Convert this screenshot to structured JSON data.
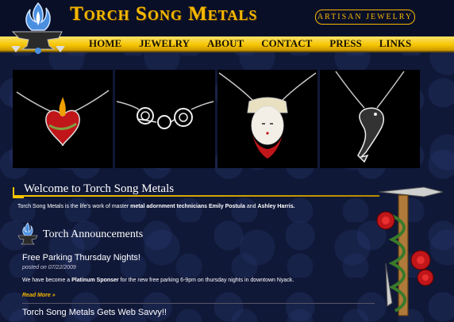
{
  "header": {
    "site_title": "Torch Song Metals",
    "badge": "ARTISAN JEWELRY"
  },
  "nav": {
    "items": [
      {
        "label": "HOME"
      },
      {
        "label": "JEWELRY"
      },
      {
        "label": "ABOUT"
      },
      {
        "label": "CONTACT"
      },
      {
        "label": "PRESS"
      },
      {
        "label": "LINKS"
      }
    ]
  },
  "welcome": {
    "title": "Welcome to Torch Song Metals",
    "intro_prefix": "Torch Song Metals is the life's work of master ",
    "intro_bold1": "metal adornment technicians Emily Postula",
    "intro_mid": " and ",
    "intro_bold2": "Ashley Harris."
  },
  "announcements": {
    "title": "Torch Announcements",
    "posts": [
      {
        "title": "Free Parking Thursday Nights!",
        "date": "posted on 07/22/2009",
        "body_prefix": "We have become a ",
        "body_bold": "Platinum Sponser",
        "body_suffix": " for the new free parking 6-9pm on thursday nights in downtown Nyack.",
        "read_more": "Read More »"
      },
      {
        "title": "Torch Song Metals Gets Web Savvy!!"
      }
    ]
  },
  "colors": {
    "gold": "#f5b800",
    "navy": "#0d1433",
    "nav_bar": "#f5c400"
  },
  "icons": [
    "anvil-flame-logo-icon",
    "anvil-flame-small-icon",
    "torch-hammer-roses-icon"
  ]
}
